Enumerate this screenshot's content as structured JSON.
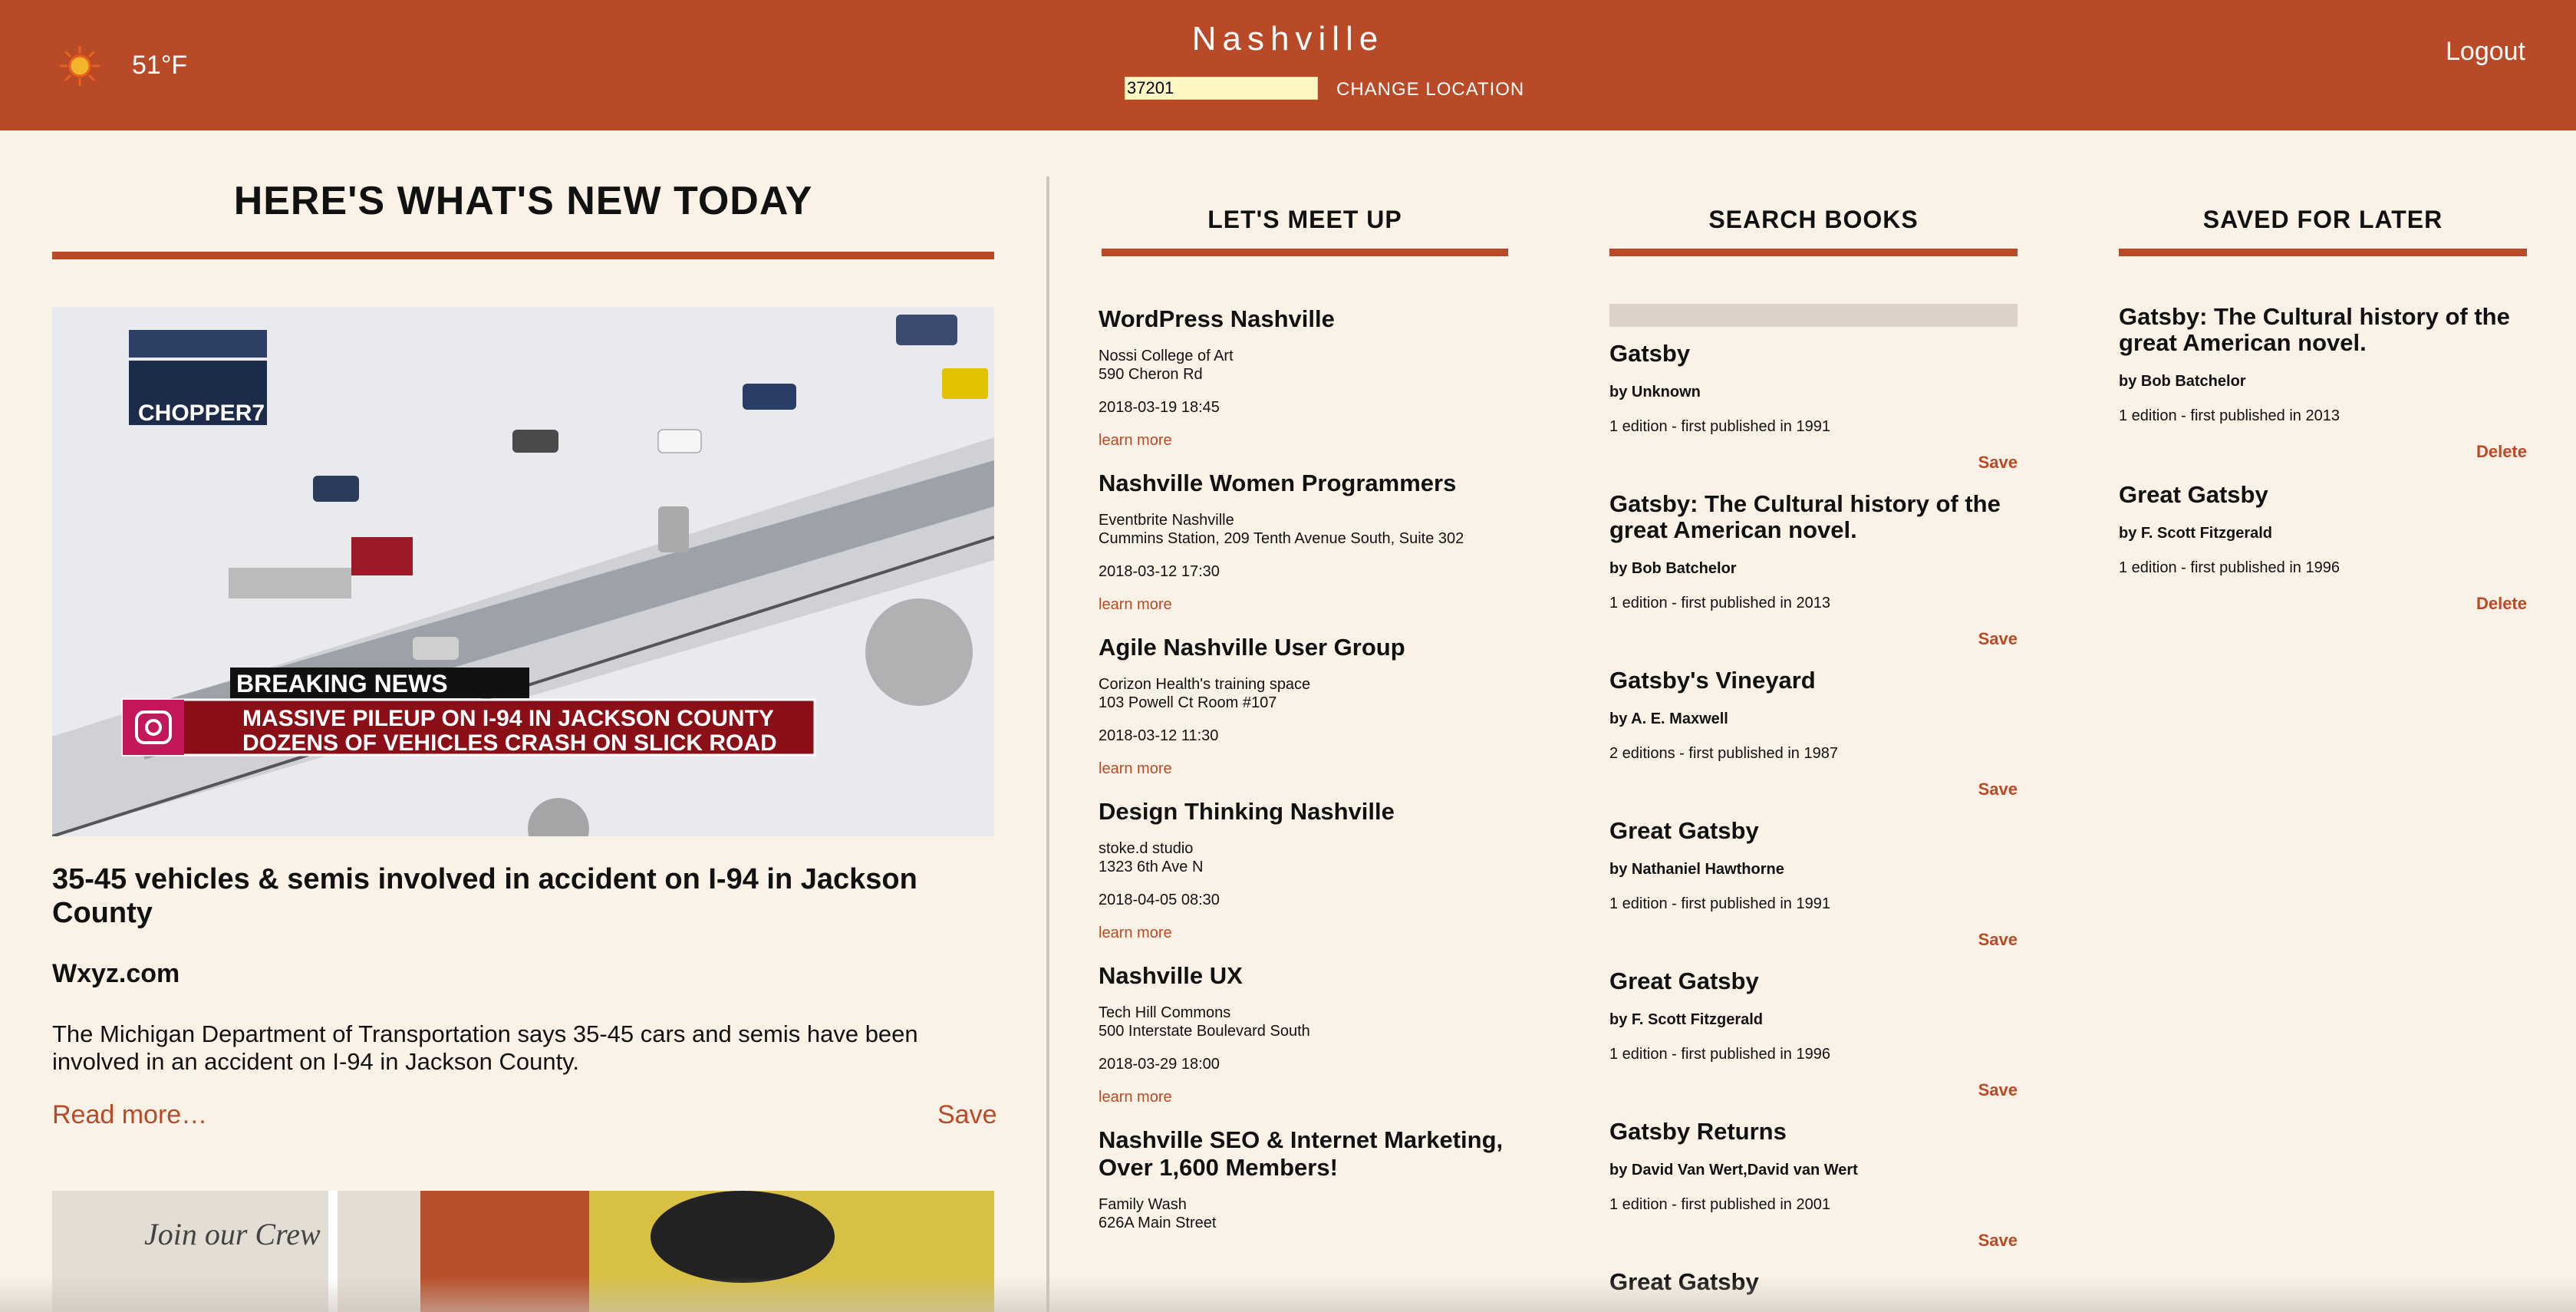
{
  "header": {
    "temperature": "51°F",
    "city": "Nashville",
    "zip_value": "37201",
    "change_location_label": "CHANGE LOCATION",
    "logout_label": "Logout",
    "weather_icon": "sun-icon",
    "accent_color": "#b94a28"
  },
  "news": {
    "heading": "HERE'S WHAT'S NEW TODAY",
    "article": {
      "image_overlay": {
        "chopper": "CHOPPER7",
        "breaking": "BREAKING NEWS",
        "line1": "MASSIVE PILEUP ON I-94 IN JACKSON COUNTY",
        "line2": "DOZENS OF VEHICLES CRASH ON SLICK ROAD"
      },
      "title": "35-45 vehicles & semis involved in accident on I-94 in Jackson County",
      "source": "Wxyz.com",
      "description": "The Michigan Department of Transportation says 35-45 cars and semis have been involved in an accident on I-94 in Jackson County.",
      "read_more": "Read more…",
      "save": "Save"
    },
    "second_image_text": "Join our Crew"
  },
  "meetups": {
    "heading": "LET'S MEET UP",
    "link_label": "learn more",
    "items": [
      {
        "name": "WordPress Nashville",
        "loc1": "Nossi College of Art",
        "loc2": "590 Cheron Rd",
        "time": "2018-03-19 18:45"
      },
      {
        "name": "Nashville Women Programmers",
        "loc1": "Eventbrite Nashville",
        "loc2": "Cummins Station, 209 Tenth Avenue South, Suite 302",
        "time": "2018-03-12 17:30"
      },
      {
        "name": "Agile Nashville User Group",
        "loc1": "Corizon Health's training space",
        "loc2": "103 Powell Ct Room #107",
        "time": "2018-03-12 11:30"
      },
      {
        "name": "Design Thinking Nashville",
        "loc1": "stoke.d studio",
        "loc2": "1323 6th Ave N",
        "time": "2018-04-05 08:30"
      },
      {
        "name": "Nashville UX",
        "loc1": "Tech Hill Commons",
        "loc2": "500 Interstate Boulevard South",
        "time": "2018-03-29 18:00"
      },
      {
        "name": "Nashville SEO & Internet Marketing, Over 1,600 Members!",
        "loc1": "Family Wash",
        "loc2": "626A Main Street",
        "time": ""
      }
    ]
  },
  "books": {
    "heading": "SEARCH BOOKS",
    "search_value": "",
    "save_label": "Save",
    "items": [
      {
        "title": "Gatsby",
        "author": "by Unknown",
        "edition": "1 edition - first published in 1991"
      },
      {
        "title": "Gatsby: The Cultural history of the great American novel.",
        "author": "by Bob Batchelor",
        "edition": "1 edition - first published in 2013"
      },
      {
        "title": "Gatsby's Vineyard",
        "author": "by A. E. Maxwell",
        "edition": "2 editions - first published in 1987"
      },
      {
        "title": "Great Gatsby",
        "author": "by Nathaniel Hawthorne",
        "edition": "1 edition - first published in 1991"
      },
      {
        "title": "Great Gatsby",
        "author": "by F. Scott Fitzgerald",
        "edition": "1 edition - first published in 1996"
      },
      {
        "title": "Gatsby Returns",
        "author": "by David Van Wert,David van Wert",
        "edition": "1 edition - first published in 2001"
      },
      {
        "title": "Great Gatsby",
        "author": "",
        "edition": ""
      }
    ]
  },
  "saved": {
    "heading": "SAVED FOR LATER",
    "delete_label": "Delete",
    "items": [
      {
        "title": "Gatsby: The Cultural history of the great American novel.",
        "author": "by Bob Batchelor",
        "edition": "1 edition - first published in 2013"
      },
      {
        "title": "Great Gatsby",
        "author": "by F. Scott Fitzgerald",
        "edition": "1 edition - first published in 1996"
      }
    ]
  }
}
